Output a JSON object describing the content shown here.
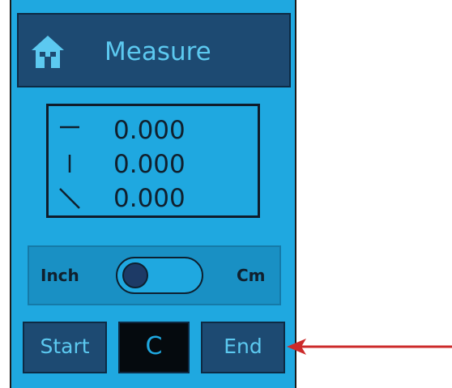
{
  "header": {
    "home_icon": "home-icon",
    "title": "Measure"
  },
  "readout": {
    "rows": [
      {
        "icon": "horizontal-line-icon",
        "value": "0.000"
      },
      {
        "icon": "vertical-line-icon",
        "value": "0.000"
      },
      {
        "icon": "diagonal-line-icon",
        "value": "0.000"
      }
    ]
  },
  "units": {
    "left_label": "Inch",
    "right_label": "Cm",
    "selected": "Inch"
  },
  "buttons": {
    "start_label": "Start",
    "clear_label": "C",
    "end_label": "End"
  },
  "colors": {
    "panel_bg": "#1fa8e0",
    "header_bg": "#1d4a72",
    "header_text": "#5cc9f0",
    "annotation_arrow": "#cc2a2a"
  }
}
